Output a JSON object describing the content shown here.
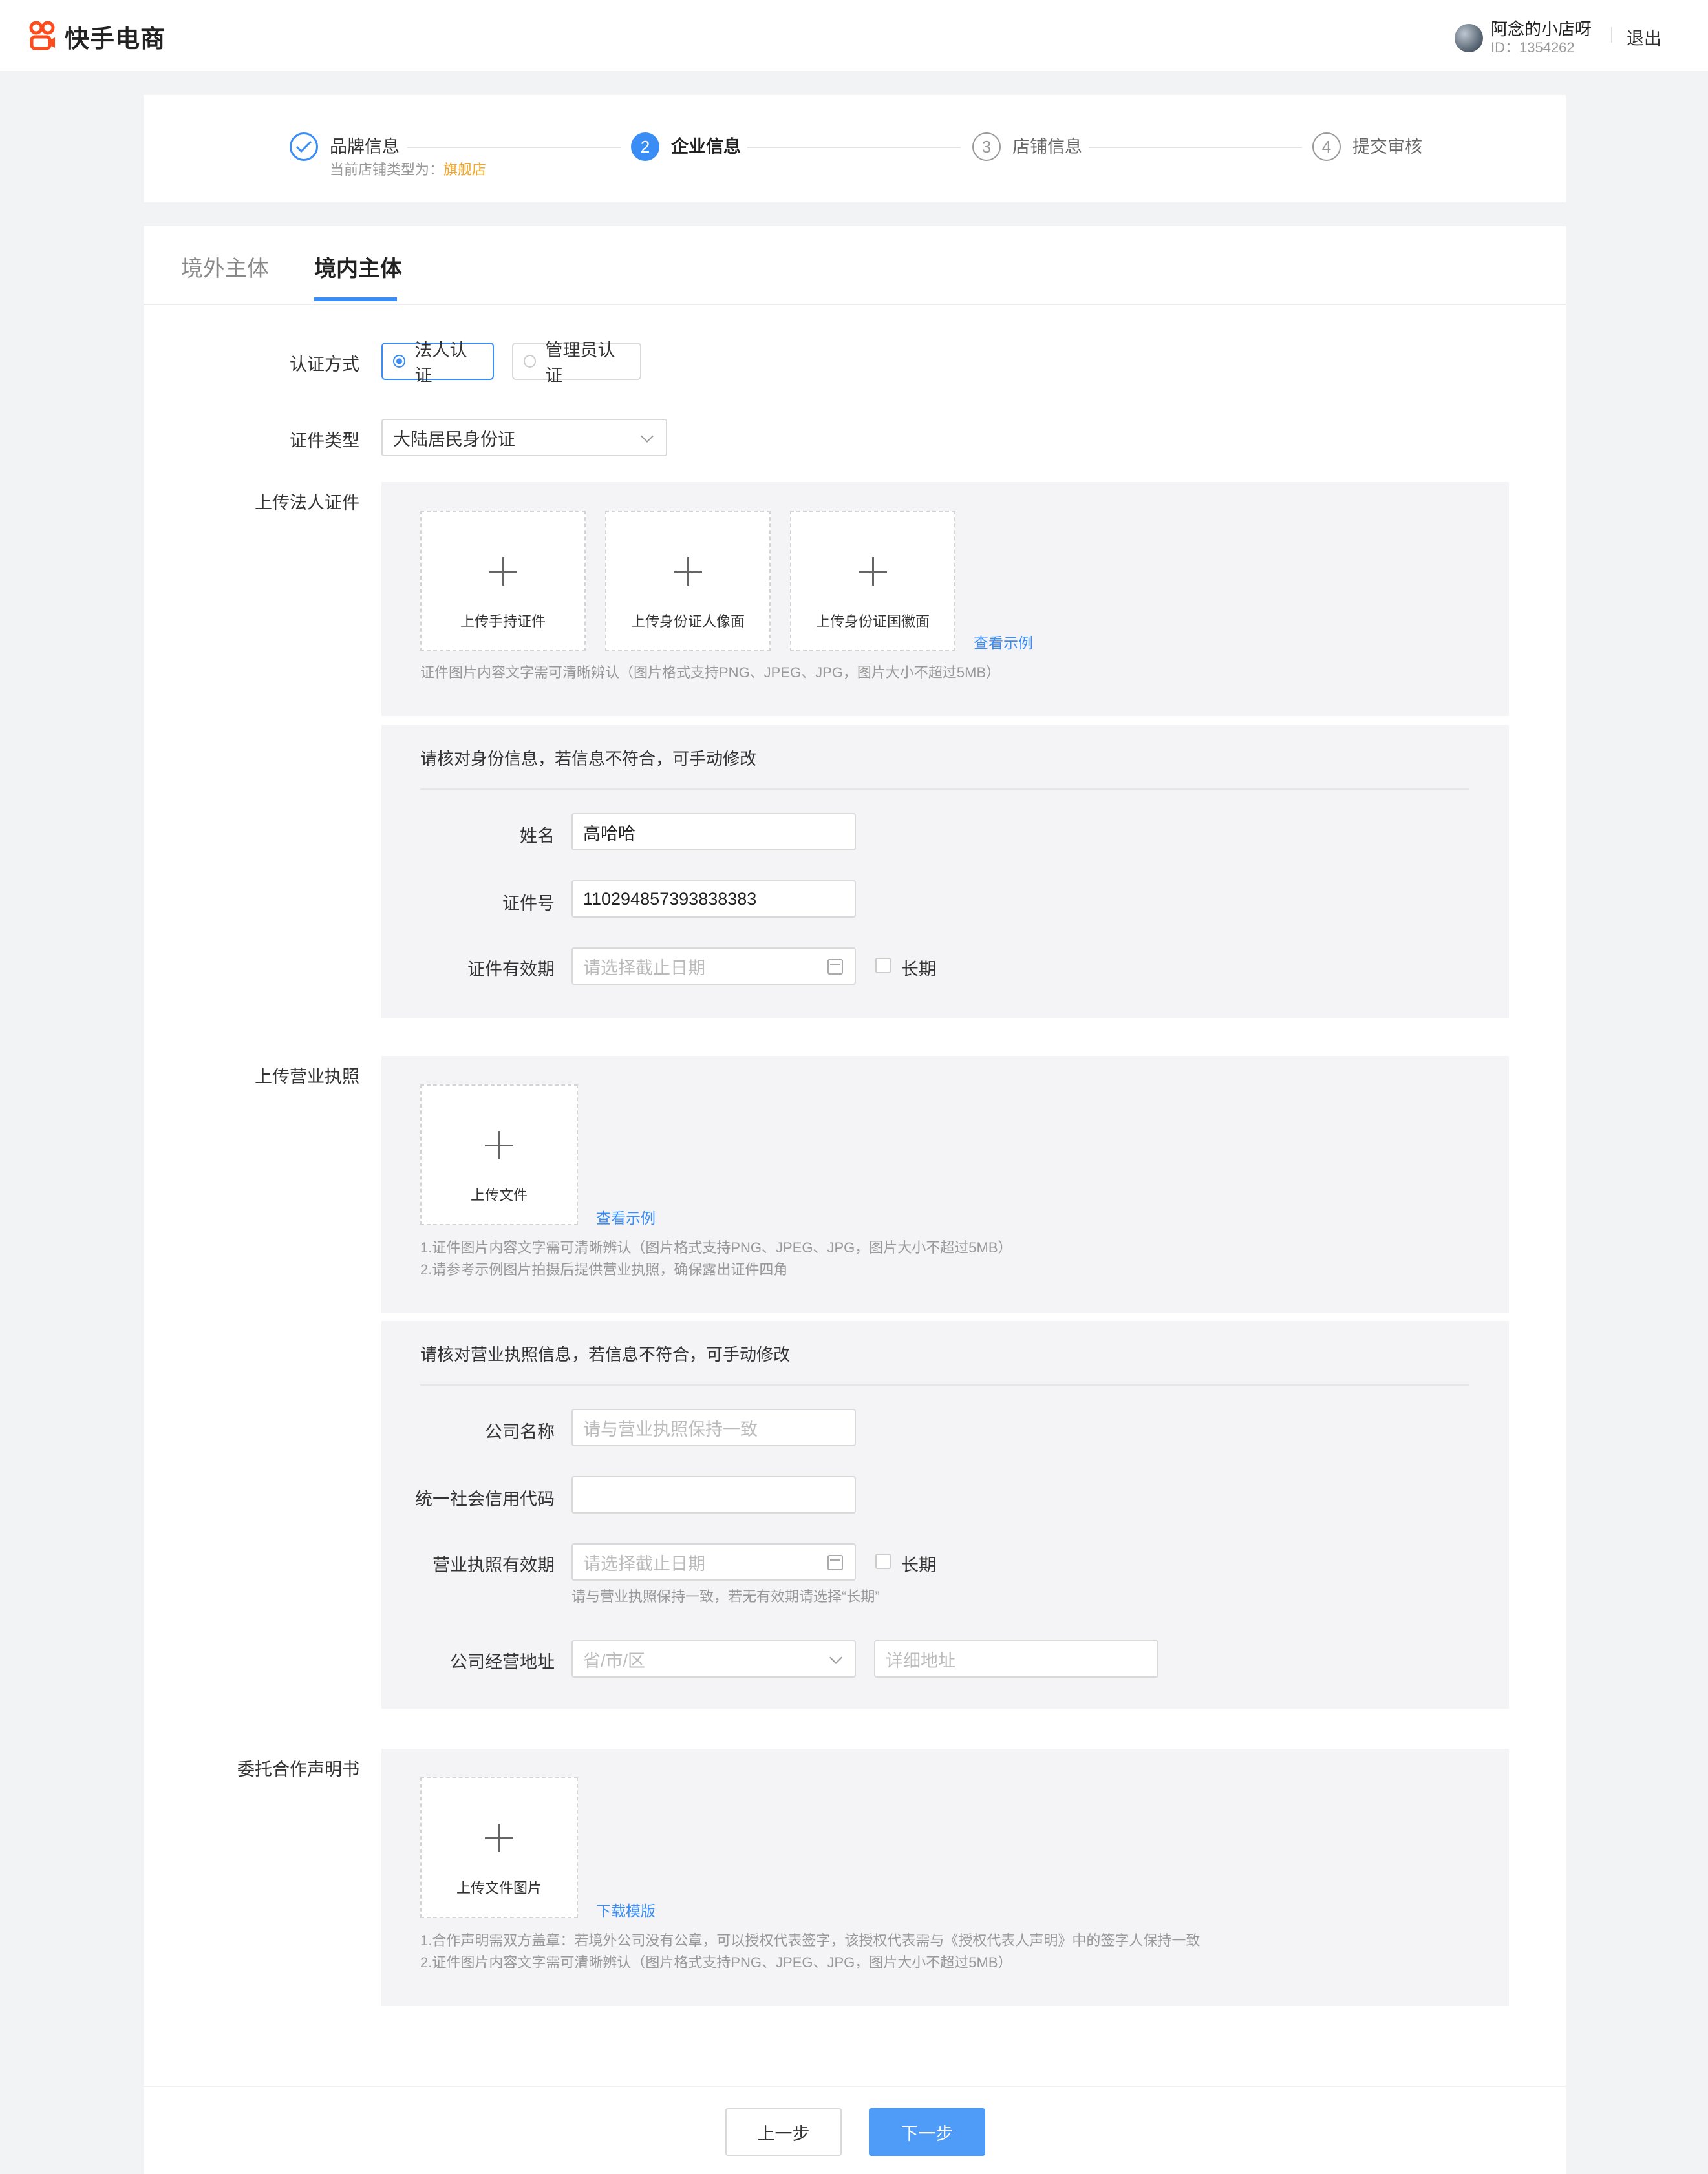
{
  "header": {
    "brand": "快手电商",
    "user_name": "阿念的小店呀",
    "user_id": "ID：1354262",
    "logout": "退出"
  },
  "steps": [
    {
      "index": "✓",
      "title": "品牌信息",
      "subtitle_prefix": "当前店铺类型为：",
      "subtitle_value": "旗舰店",
      "state": "done"
    },
    {
      "index": "2",
      "title": "企业信息",
      "state": "active"
    },
    {
      "index": "3",
      "title": "店铺信息",
      "state": "todo"
    },
    {
      "index": "4",
      "title": "提交审核",
      "state": "todo"
    }
  ],
  "tabs": [
    {
      "label": "境外主体",
      "active": false
    },
    {
      "label": "境内主体",
      "active": true
    }
  ],
  "auth": {
    "label": "认证方式",
    "options": [
      "法人认证",
      "管理员认证"
    ],
    "selected": "法人认证"
  },
  "cert_type": {
    "label": "证件类型",
    "value": "大陆居民身份证"
  },
  "legal_upload": {
    "label": "上传法人证件",
    "slots": [
      "上传手持证件",
      "上传身份证人像面",
      "上传身份证国徽面"
    ],
    "example_link": "查看示例",
    "hint": "证件图片内容文字需可清晰辨认（图片格式支持PNG、JPEG、JPG，图片大小不超过5MB）"
  },
  "identity_check": {
    "title": "请核对身份信息，若信息不符合，可手动修改",
    "name_label": "姓名",
    "name_value": "高哈哈",
    "idno_label": "证件号",
    "idno_value": "110294857393838383",
    "validity_label": "证件有效期",
    "validity_placeholder": "请选择截止日期",
    "longterm_label": "长期"
  },
  "license_upload": {
    "label": "上传营业执照",
    "slot": "上传文件",
    "example_link": "查看示例",
    "hint1": "1.证件图片内容文字需可清晰辨认（图片格式支持PNG、JPEG、JPG，图片大小不超过5MB）",
    "hint2": "2.请参考示例图片拍摄后提供营业执照，确保露出证件四角"
  },
  "license_check": {
    "title": "请核对营业执照信息，若信息不符合，可手动修改",
    "company_label": "公司名称",
    "company_placeholder": "请与营业执照保持一致",
    "credit_label": "统一社会信用代码",
    "credit_value": "",
    "validity_label": "营业执照有效期",
    "validity_placeholder": "请选择截止日期",
    "longterm_label": "长期",
    "validity_hint": "请与营业执照保持一致，若无有效期请选择“长期”",
    "address_label": "公司经营地址",
    "region_placeholder": "省/市/区",
    "detail_placeholder": "详细地址"
  },
  "entrust": {
    "label": "委托合作声明书",
    "slot": "上传文件图片",
    "template_link": "下载模版",
    "hint1": "1.合作声明需双方盖章：若境外公司没有公章，可以授权代表签字，该授权代表需与《授权代表人声明》中的签字人保持一致",
    "hint2": "2.证件图片内容文字需可清晰辨认（图片格式支持PNG、JPEG、JPG，图片大小不超过5MB）"
  },
  "footer": {
    "prev": "上一步",
    "next": "下一步"
  },
  "colors": {
    "accent": "#3b8df6",
    "brand": "#fe4b1b",
    "highlight": "#f5a623"
  }
}
